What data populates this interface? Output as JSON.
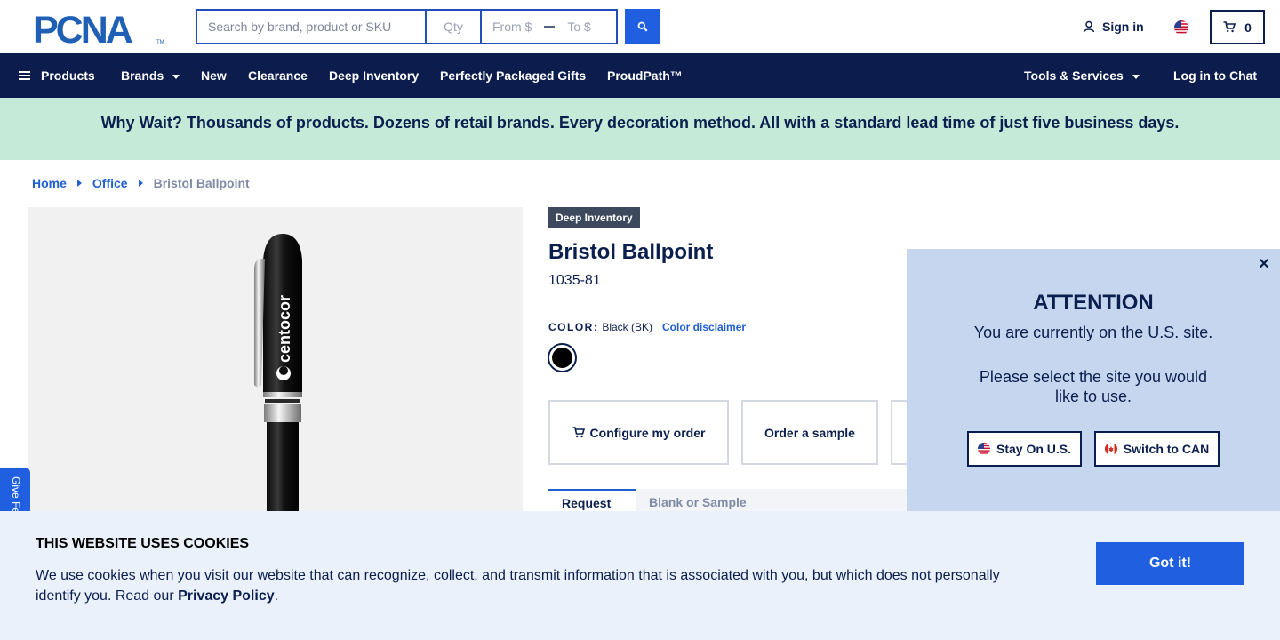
{
  "header": {
    "logo_text": "PCNA",
    "search_placeholder": "Search by brand, product or SKU",
    "qty_placeholder": "Qty",
    "price_from_placeholder": "From $",
    "price_to_placeholder": "To $",
    "signin_label": "Sign in",
    "cart_count": "0"
  },
  "nav": {
    "products": "Products",
    "brands": "Brands",
    "new": "New",
    "clearance": "Clearance",
    "deep_inventory": "Deep Inventory",
    "gifts": "Perfectly Packaged Gifts",
    "proudpath": "ProudPath™",
    "tools": "Tools & Services",
    "chat": "Log in to Chat"
  },
  "banner": {
    "text": "Why Wait? Thousands of products. Dozens of retail brands. Every decoration method. All with a standard lead time of just five business days."
  },
  "breadcrumb": {
    "home": "Home",
    "office": "Office",
    "current": "Bristol Ballpoint"
  },
  "product": {
    "badge": "Deep Inventory",
    "title": "Bristol Ballpoint",
    "sku": "1035-81",
    "color_label": "COLOR:",
    "color_value": "Black (BK)",
    "color_disclaimer": "Color disclaimer",
    "swatch_color": "#000000",
    "imprint_text": "centocor",
    "configure_label": "Configure my order",
    "sample_label": "Order a sample",
    "tab_active": "Request",
    "tab_inactive": "Blank or Sample"
  },
  "feedback": {
    "label": "Give Feedback"
  },
  "attention": {
    "title": "ATTENTION",
    "line1": "You are currently on the U.S. site.",
    "line2": "Please select the site you would like to use.",
    "stay_label": "Stay On U.S.",
    "switch_label": "Switch to CAN"
  },
  "cookie": {
    "title": "THIS WEBSITE USES COOKIES",
    "text": "We use cookies when you visit our website that can recognize, collect, and transmit information that is associated with you, but which does not personally identify you. Read our ",
    "link": "Privacy Policy",
    "period": ".",
    "button": "Got it!"
  },
  "colors": {
    "navy": "#0b1c4d",
    "accent_blue": "#1f5fe0",
    "banner_green": "#c5ead7",
    "popup_blue": "#c6d6ef",
    "cookie_bg": "#eaf1fb"
  }
}
